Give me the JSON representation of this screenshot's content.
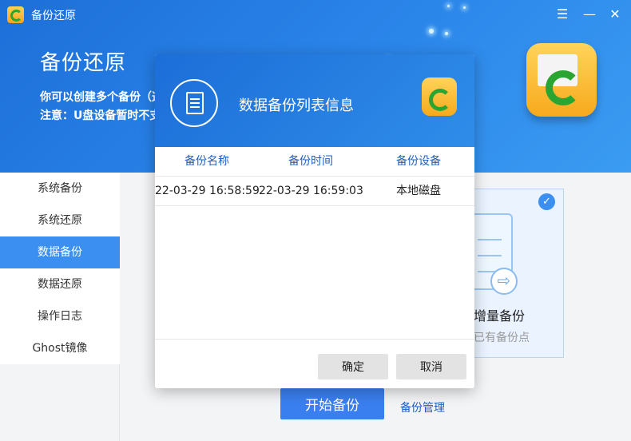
{
  "app": {
    "title": "备份还原",
    "window_controls": [
      "menu-icon",
      "minimize-icon",
      "close-icon"
    ]
  },
  "hero": {
    "title": "备份还原",
    "line1": "你可以创建多个备份（这",
    "line2": "注意：U盘设备暂时不支"
  },
  "sidebar": {
    "items": [
      {
        "label": "系统备份",
        "active": false
      },
      {
        "label": "系统还原",
        "active": false
      },
      {
        "label": "数据备份",
        "active": true
      },
      {
        "label": "数据还原",
        "active": false
      },
      {
        "label": "操作日志",
        "active": false
      },
      {
        "label": "Ghost镜像",
        "active": false
      }
    ]
  },
  "main": {
    "card_title": "增量备份",
    "card_subtitle": "已有备份点",
    "start_button": "开始备份",
    "manage_link": "备份管理"
  },
  "dialog": {
    "title": "数据备份列表信息",
    "columns": [
      "备份名称",
      "备份时间",
      "备份设备"
    ],
    "rows": [
      [
        "22-03-29 16:58:59",
        "22-03-29 16:59:03",
        "本地磁盘"
      ]
    ],
    "ok_button": "确定",
    "cancel_button": "取消"
  },
  "colors": {
    "header_blue": "#1d6fd8",
    "active_item": "#3a8ff0",
    "primary_button": "#3a7ff0",
    "link": "#1d5fc4"
  }
}
